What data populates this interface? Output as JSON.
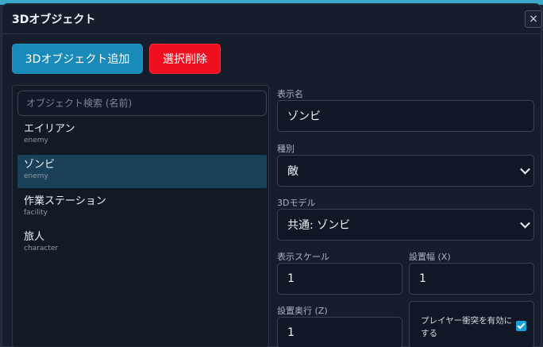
{
  "dialog": {
    "title": "3Dオブジェクト",
    "close_label": "×"
  },
  "toolbar": {
    "add_label": "3Dオブジェクト追加",
    "delete_label": "選択削除"
  },
  "search": {
    "placeholder": "オブジェクト検索 (名前)",
    "value": ""
  },
  "objects": [
    {
      "name": "エイリアン",
      "type": "enemy",
      "selected": false
    },
    {
      "name": "ゾンビ",
      "type": "enemy",
      "selected": true
    },
    {
      "name": "作業ステーション",
      "type": "facility",
      "selected": false
    },
    {
      "name": "旅人",
      "type": "character",
      "selected": false
    }
  ],
  "form": {
    "display_name_label": "表示名",
    "display_name_value": "ゾンビ",
    "kind_label": "種別",
    "kind_value": "敵",
    "model_label": "3Dモデル",
    "model_value": "共通: ゾンビ",
    "scale_label": "表示スケール",
    "scale_value": "1",
    "width_label": "設置幅 (X)",
    "width_value": "1",
    "depth_label": "設置奥行 (Z)",
    "depth_value": "1",
    "collision_label": "プレイヤー衝突を有効にする",
    "collision_checked": true
  },
  "colors": {
    "accent": "#1a8ab8",
    "danger": "#ef0f1e",
    "selected_row": "#194058"
  }
}
